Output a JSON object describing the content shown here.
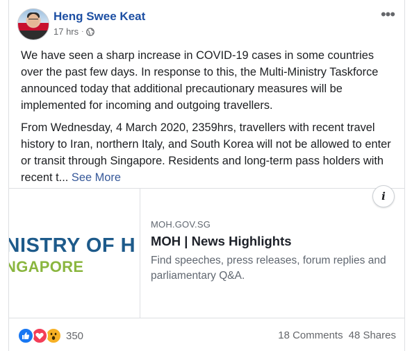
{
  "post": {
    "author": "Heng Swee Keat",
    "time": "17 hrs",
    "separator": "·",
    "privacy_icon": "globe-icon",
    "more_icon": "more-options-icon",
    "paragraph1": "We have seen a sharp increase in COVID-19 cases in some countries over the past few days. In response to this, the Multi-Ministry Taskforce announced today that additional precautionary measures will be implemented for incoming and outgoing travellers.",
    "paragraph2": "From Wednesday, 4 March 2020, 2359hrs, travellers with recent travel history to Iran, northern Italy, and South Korea will not be allowed to enter or transit through Singapore. Residents and long-term pass holders with recent t...",
    "see_more": "See More"
  },
  "link_preview": {
    "image_line1": "INISTRY OF H",
    "image_line2": "NGAPORE",
    "info_label": "i",
    "domain": "MOH.GOV.SG",
    "title": "MOH | News Highlights",
    "description": "Find speeches, press releases, forum replies and parliamentary Q&A."
  },
  "footer": {
    "reaction_count": "350",
    "comments": "18 Comments",
    "shares": "48 Shares"
  },
  "colors": {
    "name": "#1d4fa3",
    "like": "#1877f2",
    "love": "#f33e58",
    "wow": "#f7b125",
    "see_more": "#365899"
  }
}
